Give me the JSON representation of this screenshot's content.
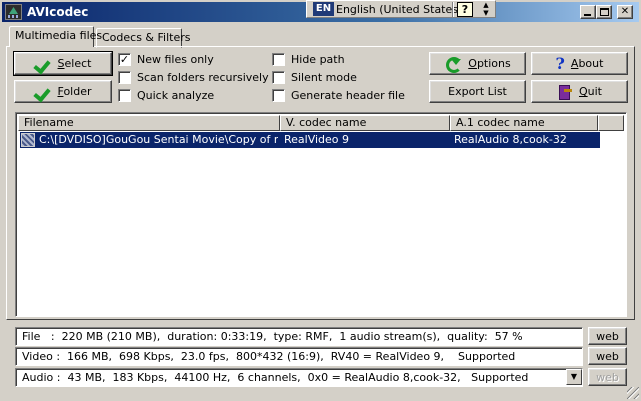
{
  "window": {
    "title": "AVIcodec"
  },
  "language_bar": {
    "code": "EN",
    "name": "English (United States)",
    "help": "?"
  },
  "tabs": [
    {
      "label": "Multimedia files",
      "active": true
    },
    {
      "label": "Codecs & Filters",
      "active": false
    }
  ],
  "buttons": {
    "select": {
      "underline": "S",
      "rest": "elect"
    },
    "folder": {
      "underline": "F",
      "rest": "older"
    },
    "options": {
      "underline": "O",
      "rest": "ptions"
    },
    "about": {
      "underline": "A",
      "rest": "bout"
    },
    "export": {
      "label": "Export List"
    },
    "quit": {
      "underline": "Q",
      "rest": "uit"
    }
  },
  "options": {
    "new_files_only": {
      "label": "New files only",
      "checked": true
    },
    "scan_recursively": {
      "label": "Scan folders recursively",
      "checked": false
    },
    "quick_analyze": {
      "label": "Quick analyze",
      "checked": false
    },
    "hide_path": {
      "label": "Hide path",
      "checked": false
    },
    "silent_mode": {
      "label": "Silent mode",
      "checked": false
    },
    "generate_header": {
      "label": "Generate header file",
      "checked": false
    }
  },
  "file_list": {
    "columns": [
      "Filename",
      "V. codec name",
      "A.1 codec name"
    ],
    "rows": [
      {
        "filename": "C:\\[DVDISO]GouGou Sentai Movie\\Copy of mo...",
        "video_codec": "RealVideo 9",
        "audio_codec": "RealAudio 8,cook-32",
        "selected": true
      }
    ]
  },
  "info": {
    "file": "File   :  220 MB (210 MB),  duration: 0:33:19,  type: RMF,  1 audio stream(s),  quality:  57 %",
    "video": "Video :  166 MB,  698 Kbps,  23.0 fps,  800*432 (16:9),  RV40 = RealVideo 9,    Supported",
    "audio": "Audio :  43 MB,  183 Kbps,  44100 Hz,  6 channels,  0x0 = RealAudio 8,cook-32,   Supported"
  },
  "web_label": "web",
  "colors": {
    "title_start": "#0a246a",
    "title_end": "#a6caf0",
    "selection": "#0a246a",
    "face": "#d4d0c8"
  }
}
